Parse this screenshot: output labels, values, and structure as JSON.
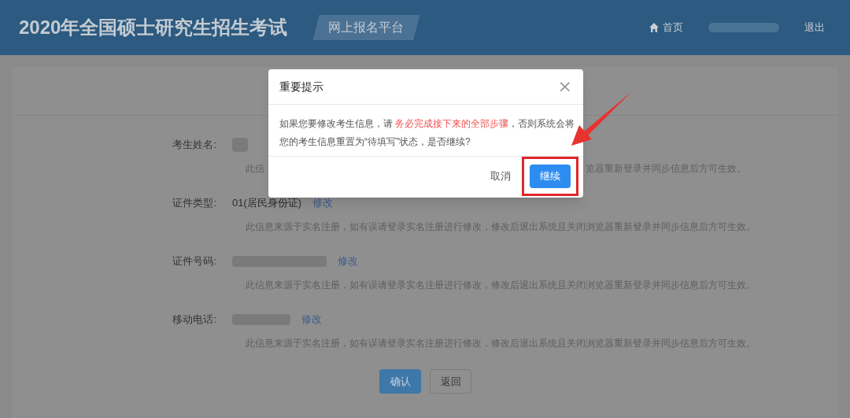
{
  "header": {
    "title": "2020年全国硕士研究生招生考试",
    "badge": "网上报名平台",
    "nav": [
      {
        "kind": "home",
        "label": "首页"
      },
      {
        "kind": "redacted"
      },
      {
        "kind": "text",
        "label": "退出"
      }
    ]
  },
  "fields": [
    {
      "label": "考生姓名:",
      "kind": "redacted",
      "hint_parts": [
        "此信",
        "览器重新登录并同步信息后方可生效。"
      ]
    },
    {
      "label": "证件类型:",
      "kind": "text",
      "value": "01(居民身份证)",
      "link": "修改",
      "hint_parts": [
        "此信息来源于实名注册，如有误请登录实名注册进行修改，修改后退出系统且关闭浏览器重新登录并同步信息后方可生效。"
      ]
    },
    {
      "label": "证件号码:",
      "kind": "redacted",
      "link": "修改",
      "hint_parts": [
        "此信息来源于实名注册，如有误请登录实名注册进行修改，修改后退出系统且关闭浏览器重新登录并同步信息后方可生效。"
      ]
    },
    {
      "label": "移动电话:",
      "kind": "redacted",
      "link": "修改",
      "hint_parts": [
        "此信息来源于实名注册，如有误请登录实名注册进行修改，修改后退出系统且关闭浏览器重新登录并同步信息后方可生效。"
      ]
    }
  ],
  "buttons": [
    {
      "label": "确认",
      "kind": "primary"
    },
    {
      "label": "返回",
      "kind": "default"
    }
  ],
  "dialog": {
    "title": "重要提示",
    "close": "×",
    "message": [
      [
        {
          "text": "如果您要修改考生信息，请 ",
          "emphasis": false
        },
        {
          "text": "务必完成接下来的全部步骤",
          "emphasis": true
        },
        {
          "text": "，否则系统会将",
          "emphasis": false
        }
      ],
      [
        {
          "text": "您的考生信息重置为“待填写”状态，是否继续?",
          "emphasis": false
        }
      ]
    ],
    "buttons": [
      {
        "label": "取消",
        "kind": "text",
        "highlighted": false
      },
      {
        "label": "继续",
        "kind": "primary",
        "highlighted": true
      }
    ]
  }
}
